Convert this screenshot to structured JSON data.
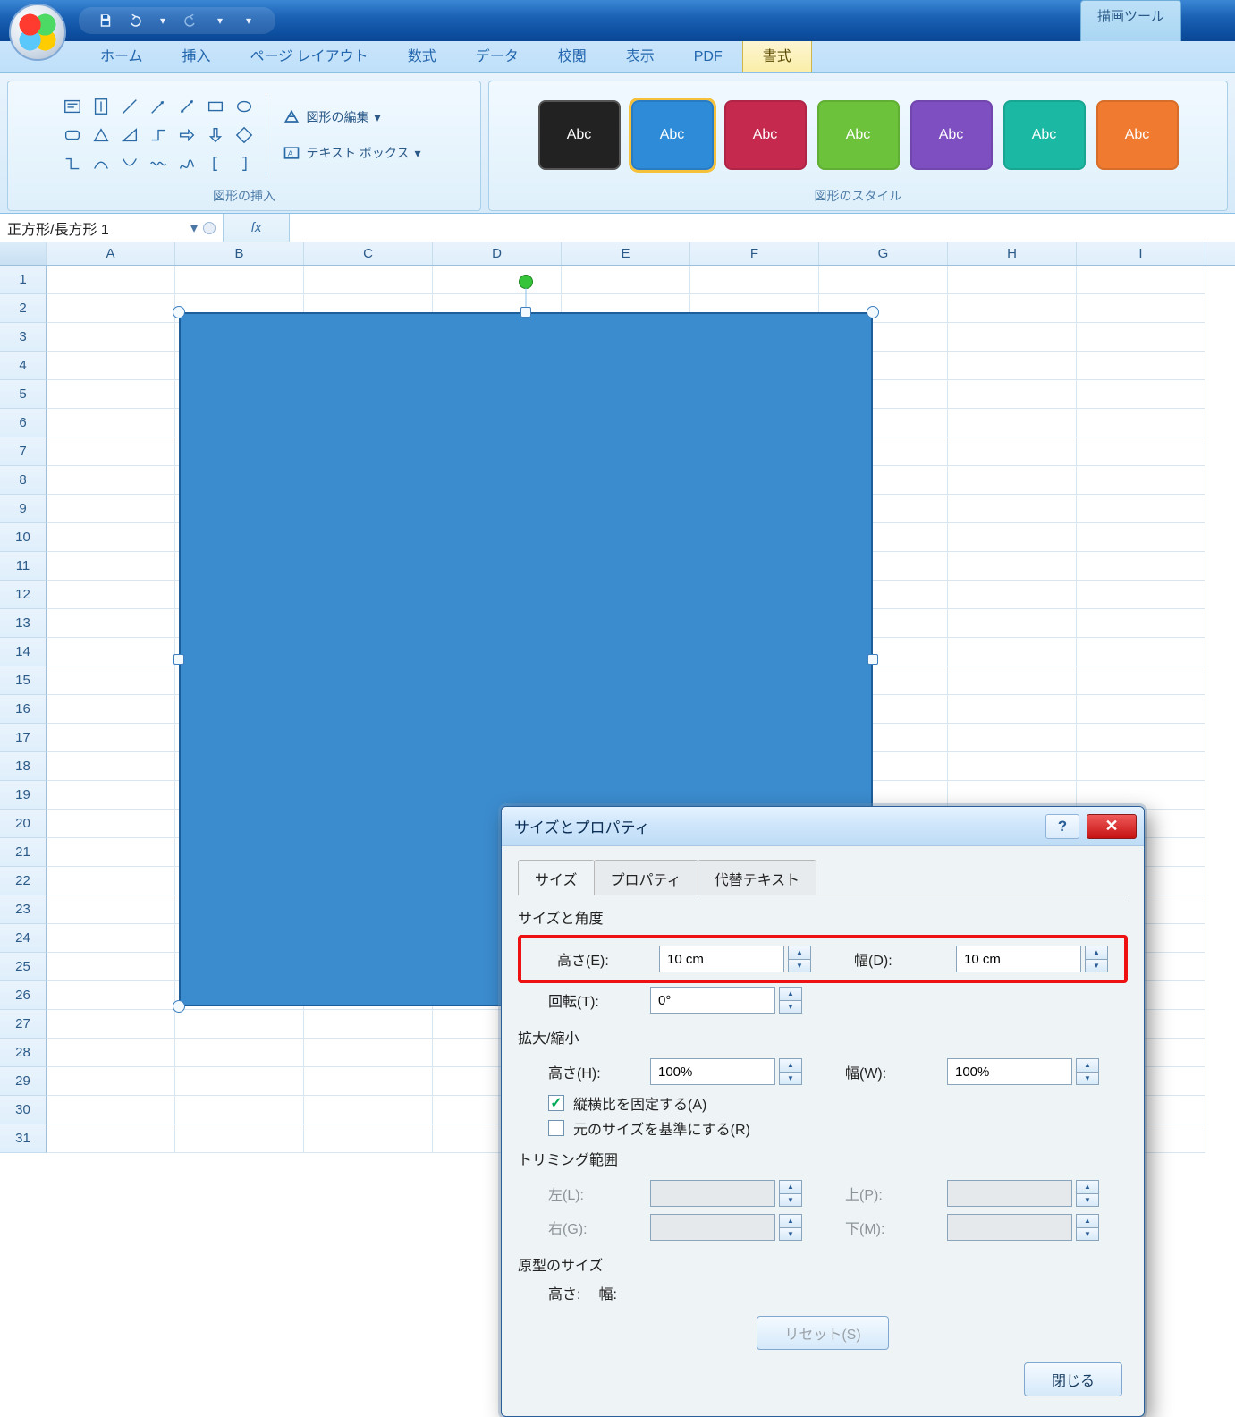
{
  "drawing_tools_label": "描画ツール",
  "tabs": [
    "ホーム",
    "挿入",
    "ページ レイアウト",
    "数式",
    "データ",
    "校閲",
    "表示",
    "PDF",
    "書式"
  ],
  "active_tab_index": 8,
  "ribbon": {
    "group_insert": "図形の挿入",
    "group_styles": "図形のスタイル",
    "edit_shape": "図形の編集",
    "text_box": "テキスト ボックス",
    "style_label": "Abc",
    "style_colors": [
      "#222222",
      "#2e8bd8",
      "#c52a4e",
      "#6cc23a",
      "#7e4fc1",
      "#1bb9a3",
      "#f07a2f"
    ],
    "selected_style_index": 1
  },
  "name_box": "正方形/長方形 1",
  "fx": "fx",
  "columns": [
    "A",
    "B",
    "C",
    "D",
    "E",
    "F",
    "G",
    "H",
    "I"
  ],
  "row_count": 31,
  "dialog": {
    "title": "サイズとプロパティ",
    "tabs": [
      "サイズ",
      "プロパティ",
      "代替テキスト"
    ],
    "active_tab_index": 0,
    "section_size_angle": "サイズと角度",
    "height_e": "高さ(E):",
    "width_d": "幅(D):",
    "rotation_t": "回転(T):",
    "height_e_val": "10 cm",
    "width_d_val": "10 cm",
    "rotation_t_val": "0°",
    "section_scale": "拡大/縮小",
    "height_h": "高さ(H):",
    "width_w": "幅(W):",
    "height_h_val": "100%",
    "width_w_val": "100%",
    "lock_aspect": "縦横比を固定する(A)",
    "lock_aspect_checked": true,
    "relative_original": "元のサイズを基準にする(R)",
    "relative_original_checked": false,
    "section_crop": "トリミング範囲",
    "left_l": "左(L):",
    "right_g": "右(G):",
    "top_p": "上(P):",
    "bottom_m": "下(M):",
    "section_original": "原型のサイズ",
    "orig_height": "高さ:",
    "orig_width": "幅:",
    "reset": "リセット(S)",
    "close": "閉じる"
  }
}
